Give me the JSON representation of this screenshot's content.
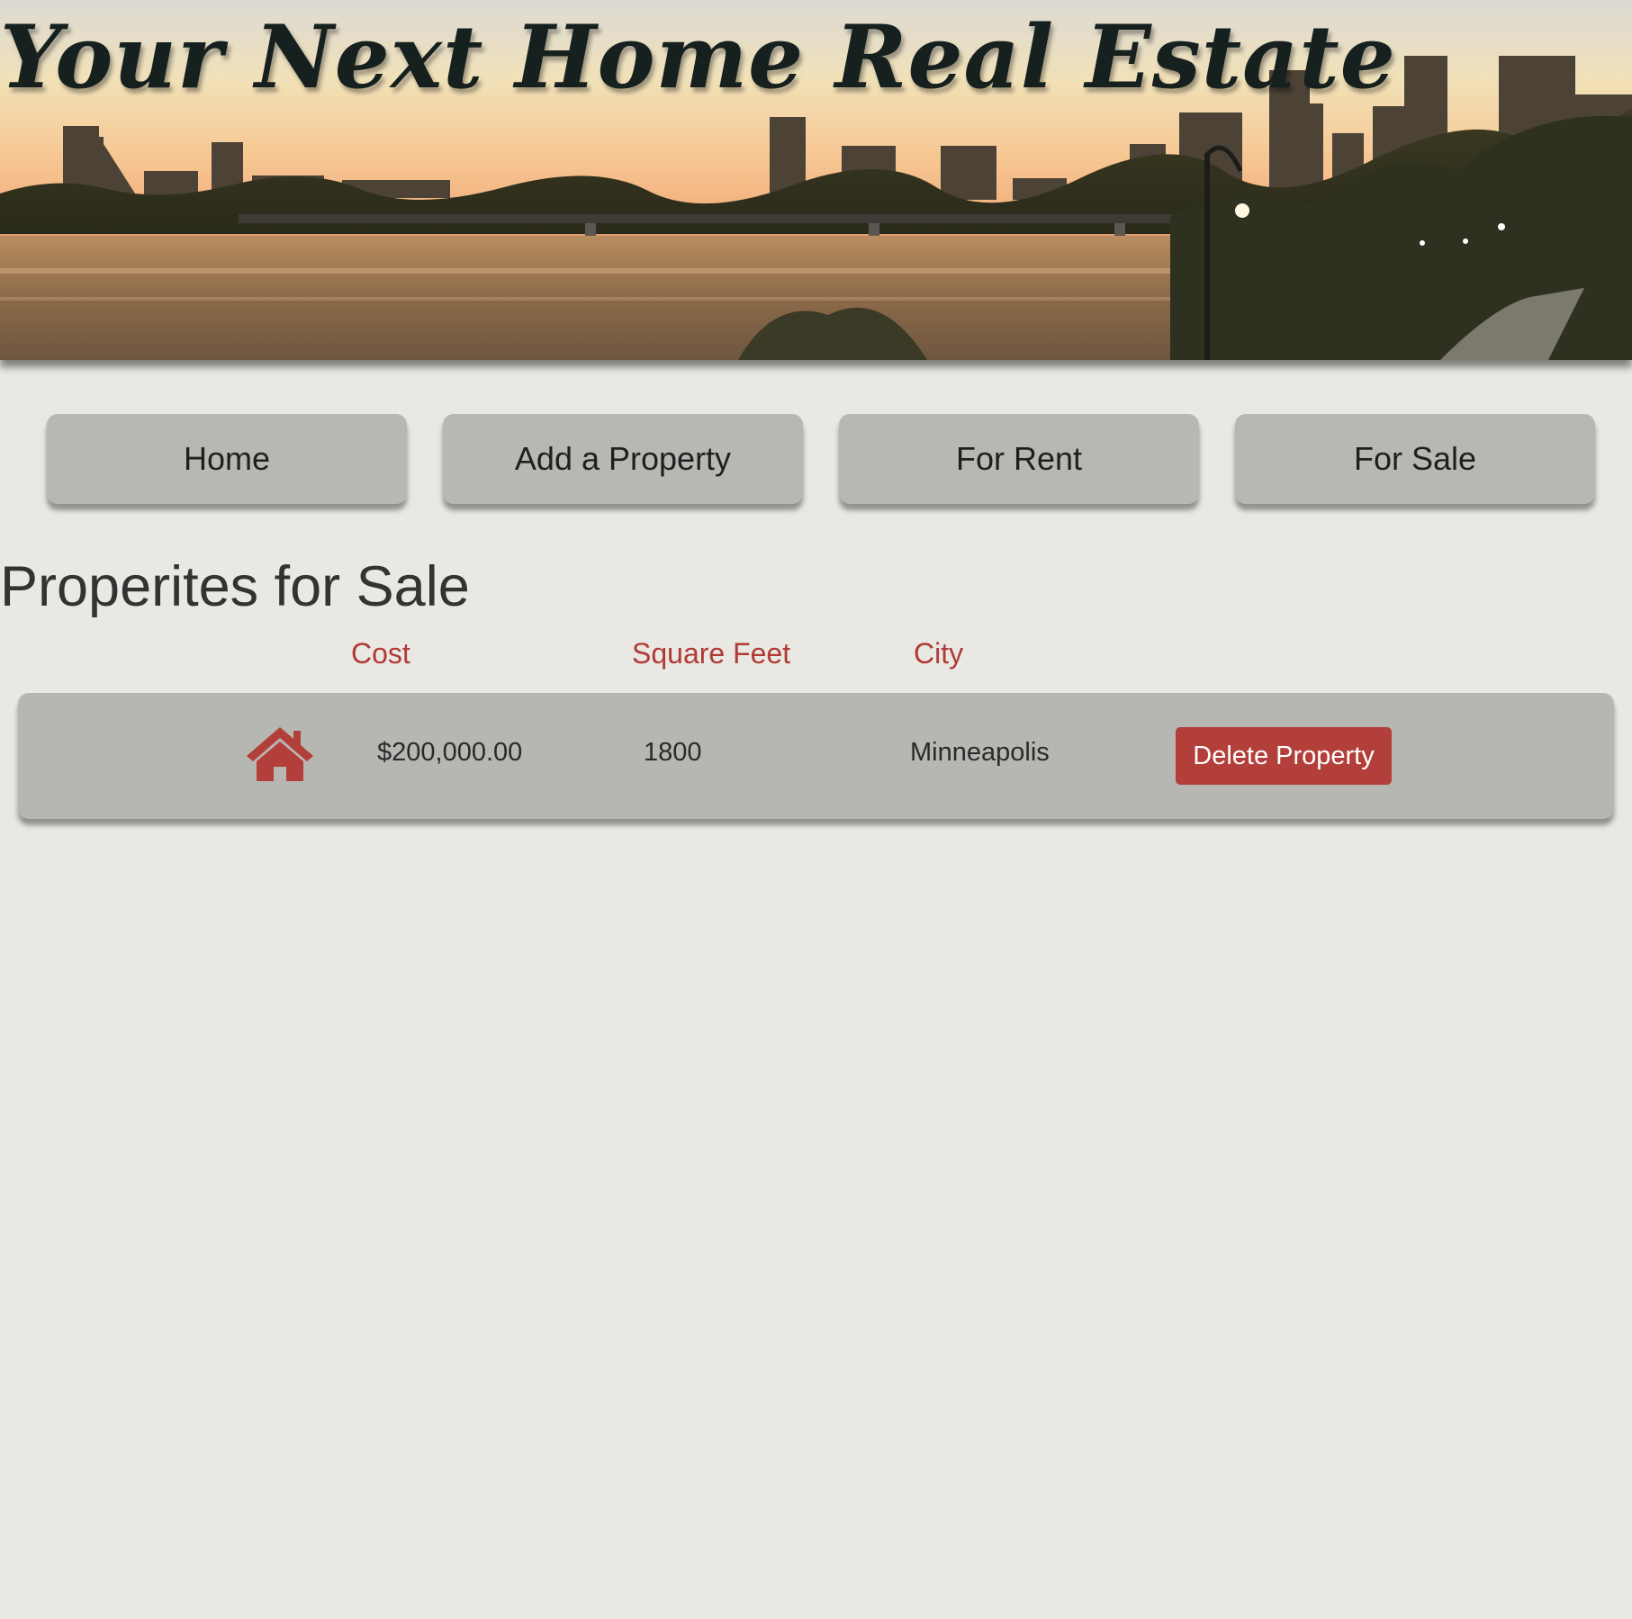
{
  "header": {
    "title": "Your Next Home Real Estate"
  },
  "nav": {
    "items": [
      {
        "label": "Home"
      },
      {
        "label": "Add a Property"
      },
      {
        "label": "For Rent"
      },
      {
        "label": "For Sale"
      }
    ]
  },
  "main": {
    "heading": "Properites for Sale",
    "columns": {
      "cost": "Cost",
      "sqft": "Square Feet",
      "city": "City"
    },
    "properties": [
      {
        "icon": "house-icon",
        "cost": "$200,000.00",
        "sqft": "1800",
        "city": "Minneapolis",
        "delete_label": "Delete Property"
      }
    ]
  },
  "colors": {
    "background": "#e9e8e3",
    "card": "#b6b6b3",
    "accent": "#b33f3a",
    "header_accent": "#b03a36"
  }
}
